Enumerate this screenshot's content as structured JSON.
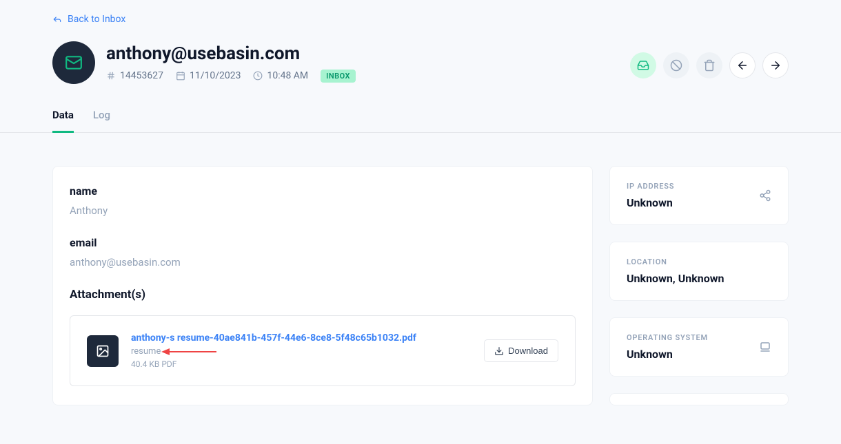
{
  "back_link": "Back to Inbox",
  "header": {
    "title": "anthony@usebasin.com",
    "submission_id": "14453627",
    "date": "11/10/2023",
    "time": "10:48 AM",
    "badge": "INBOX"
  },
  "tabs": [
    {
      "label": "Data",
      "active": true
    },
    {
      "label": "Log",
      "active": false
    }
  ],
  "fields": {
    "name": {
      "label": "name",
      "value": "Anthony"
    },
    "email": {
      "label": "email",
      "value": "anthony@usebasin.com"
    }
  },
  "attachments": {
    "section_title": "Attachment(s)",
    "items": [
      {
        "filename": "anthony-s resume-40ae841b-457f-44e6-8ce8-5f48c65b1032.pdf",
        "field_name": "resume",
        "meta": "40.4 KB PDF",
        "download_label": "Download"
      }
    ]
  },
  "sidebar": {
    "ip": {
      "label": "IP ADDRESS",
      "value": "Unknown"
    },
    "location": {
      "label": "LOCATION",
      "value": "Unknown, Unknown"
    },
    "os": {
      "label": "OPERATING SYSTEM",
      "value": "Unknown"
    }
  }
}
